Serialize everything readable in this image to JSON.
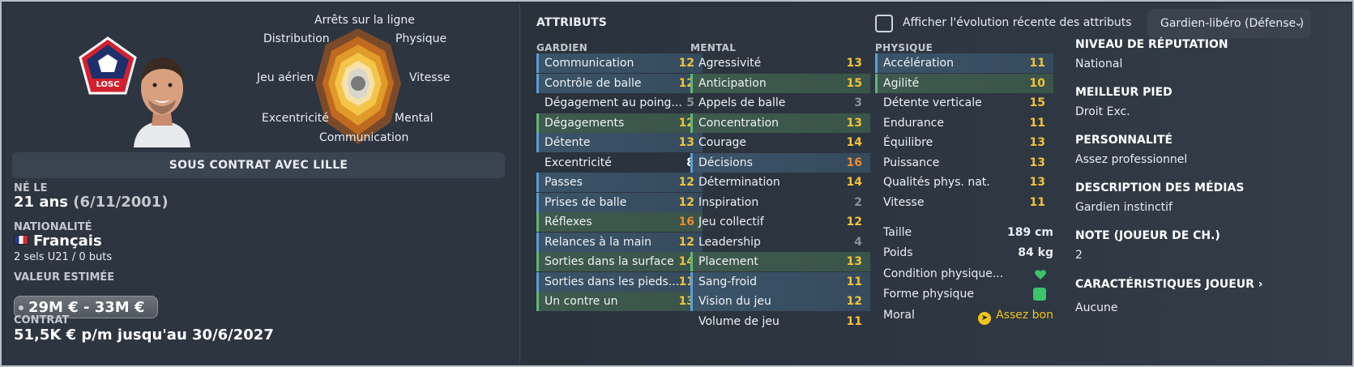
{
  "left": {
    "club_crest_text": "LOSC",
    "radar_labels": {
      "top": "Arrêts sur la ligne",
      "top_left": "Distribution",
      "top_right": "Physique",
      "left": "Jeu aérien",
      "right": "Vitesse",
      "bottom_left": "Excentricité",
      "bottom_right": "Mental",
      "bottom": "Communication"
    },
    "contract_banner": "SOUS CONTRAT AVEC LILLE",
    "born_label": "NÉ LE",
    "age": "21 ans",
    "birth_date": "(6/11/2001)",
    "nationality_label": "NATIONALITÉ",
    "nationality": "Français",
    "caps": "2 sels U21 / 0 buts",
    "value_label": "VALEUR ESTIMÉE",
    "value": "29M € - 33M €",
    "contract_label": "CONTRAT",
    "contract": "51,5K € p/m jusqu'au 30/6/2027"
  },
  "attributes": {
    "title": "ATTRIBUTS",
    "show_evolution_label": "Afficher l'évolution récente des attributs",
    "role_select": "Gardien-libéro (Défense )",
    "goalkeeper_head": "GARDIEN",
    "mental_head": "MENTAL",
    "physical_head": "PHYSIQUE",
    "goalkeeper": [
      {
        "name": "Communication",
        "value": "12",
        "hl": "blue",
        "tone": "yellow"
      },
      {
        "name": "Contrôle de balle",
        "value": "12",
        "hl": "blue",
        "tone": "yellow"
      },
      {
        "name": "Dégagement au poing...",
        "value": "5",
        "hl": "none",
        "tone": "low"
      },
      {
        "name": "Dégagements",
        "value": "12",
        "hl": "green",
        "tone": "yellow"
      },
      {
        "name": "Détente",
        "value": "13",
        "hl": "blue",
        "tone": "yellow"
      },
      {
        "name": "Excentricité",
        "value": "8",
        "hl": "none",
        "tone": "white"
      },
      {
        "name": "Passes",
        "value": "12",
        "hl": "blue",
        "tone": "yellow"
      },
      {
        "name": "Prises de balle",
        "value": "12",
        "hl": "blue",
        "tone": "yellow"
      },
      {
        "name": "Réflexes",
        "value": "16",
        "hl": "green",
        "tone": "orange"
      },
      {
        "name": "Relances à la main",
        "value": "12",
        "hl": "blue",
        "tone": "yellow"
      },
      {
        "name": "Sorties dans la surface",
        "value": "14",
        "hl": "green",
        "tone": "yellow"
      },
      {
        "name": "Sorties dans les pieds...",
        "value": "11",
        "hl": "blue",
        "tone": "yellow"
      },
      {
        "name": "Un contre un",
        "value": "13",
        "hl": "green",
        "tone": "yellow"
      }
    ],
    "mental": [
      {
        "name": "Agressivité",
        "value": "13",
        "hl": "none",
        "tone": "yellow"
      },
      {
        "name": "Anticipation",
        "value": "15",
        "hl": "green",
        "tone": "yellow"
      },
      {
        "name": "Appels de balle",
        "value": "3",
        "hl": "none",
        "tone": "low"
      },
      {
        "name": "Concentration",
        "value": "13",
        "hl": "green",
        "tone": "yellow"
      },
      {
        "name": "Courage",
        "value": "14",
        "hl": "none",
        "tone": "yellow"
      },
      {
        "name": "Décisions",
        "value": "16",
        "hl": "blue",
        "tone": "orange"
      },
      {
        "name": "Détermination",
        "value": "14",
        "hl": "none",
        "tone": "yellow"
      },
      {
        "name": "Inspiration",
        "value": "2",
        "hl": "none",
        "tone": "low"
      },
      {
        "name": "Jeu collectif",
        "value": "12",
        "hl": "none",
        "tone": "yellow"
      },
      {
        "name": "Leadership",
        "value": "4",
        "hl": "none",
        "tone": "low"
      },
      {
        "name": "Placement",
        "value": "13",
        "hl": "green",
        "tone": "yellow"
      },
      {
        "name": "Sang-froid",
        "value": "11",
        "hl": "blue",
        "tone": "yellow"
      },
      {
        "name": "Vision du jeu",
        "value": "12",
        "hl": "blue",
        "tone": "yellow"
      },
      {
        "name": "Volume de jeu",
        "value": "11",
        "hl": "none",
        "tone": "yellow"
      }
    ],
    "physical": [
      {
        "name": "Accélération",
        "value": "11",
        "hl": "blue",
        "tone": "yellow"
      },
      {
        "name": "Agilité",
        "value": "10",
        "hl": "green",
        "tone": "yellow"
      },
      {
        "name": "Détente verticale",
        "value": "15",
        "hl": "none",
        "tone": "yellow"
      },
      {
        "name": "Endurance",
        "value": "11",
        "hl": "none",
        "tone": "yellow"
      },
      {
        "name": "Équilibre",
        "value": "13",
        "hl": "none",
        "tone": "yellow"
      },
      {
        "name": "Puissance",
        "value": "13",
        "hl": "none",
        "tone": "yellow"
      },
      {
        "name": "Qualités phys. nat.",
        "value": "13",
        "hl": "none",
        "tone": "yellow"
      },
      {
        "name": "Vitesse",
        "value": "11",
        "hl": "none",
        "tone": "yellow"
      }
    ],
    "physical_stats": {
      "height_label": "Taille",
      "height": "189 cm",
      "weight_label": "Poids",
      "weight": "84 kg",
      "condition_label": "Condition physique...",
      "form_label": "Forme physique",
      "morale_label": "Moral",
      "morale": "Assez bon"
    }
  },
  "side": {
    "reputation_label": "NIVEAU DE RÉPUTATION",
    "reputation": "National",
    "foot_label": "MEILLEUR PIED",
    "foot": "Droit Exc.",
    "personality_label": "PERSONNALITÉ",
    "personality": "Assez professionnel",
    "media_label": "DESCRIPTION DES MÉDIAS",
    "media": "Gardien instinctif",
    "rating_label": "NOTE (JOUEUR DE CH.)",
    "rating": "2",
    "traits_label": "CARACTÉRISTIQUES JOUEUR ›",
    "traits": "Aucune"
  },
  "colors": {
    "panel": "#2c3540",
    "accent_blue": "#5b9fd6",
    "accent_green": "#5fb57a",
    "value_yellow": "#f1c23a",
    "value_orange": "#ee8a2c",
    "crest_red": "#d3202e",
    "crest_blue": "#1e2f6e"
  }
}
